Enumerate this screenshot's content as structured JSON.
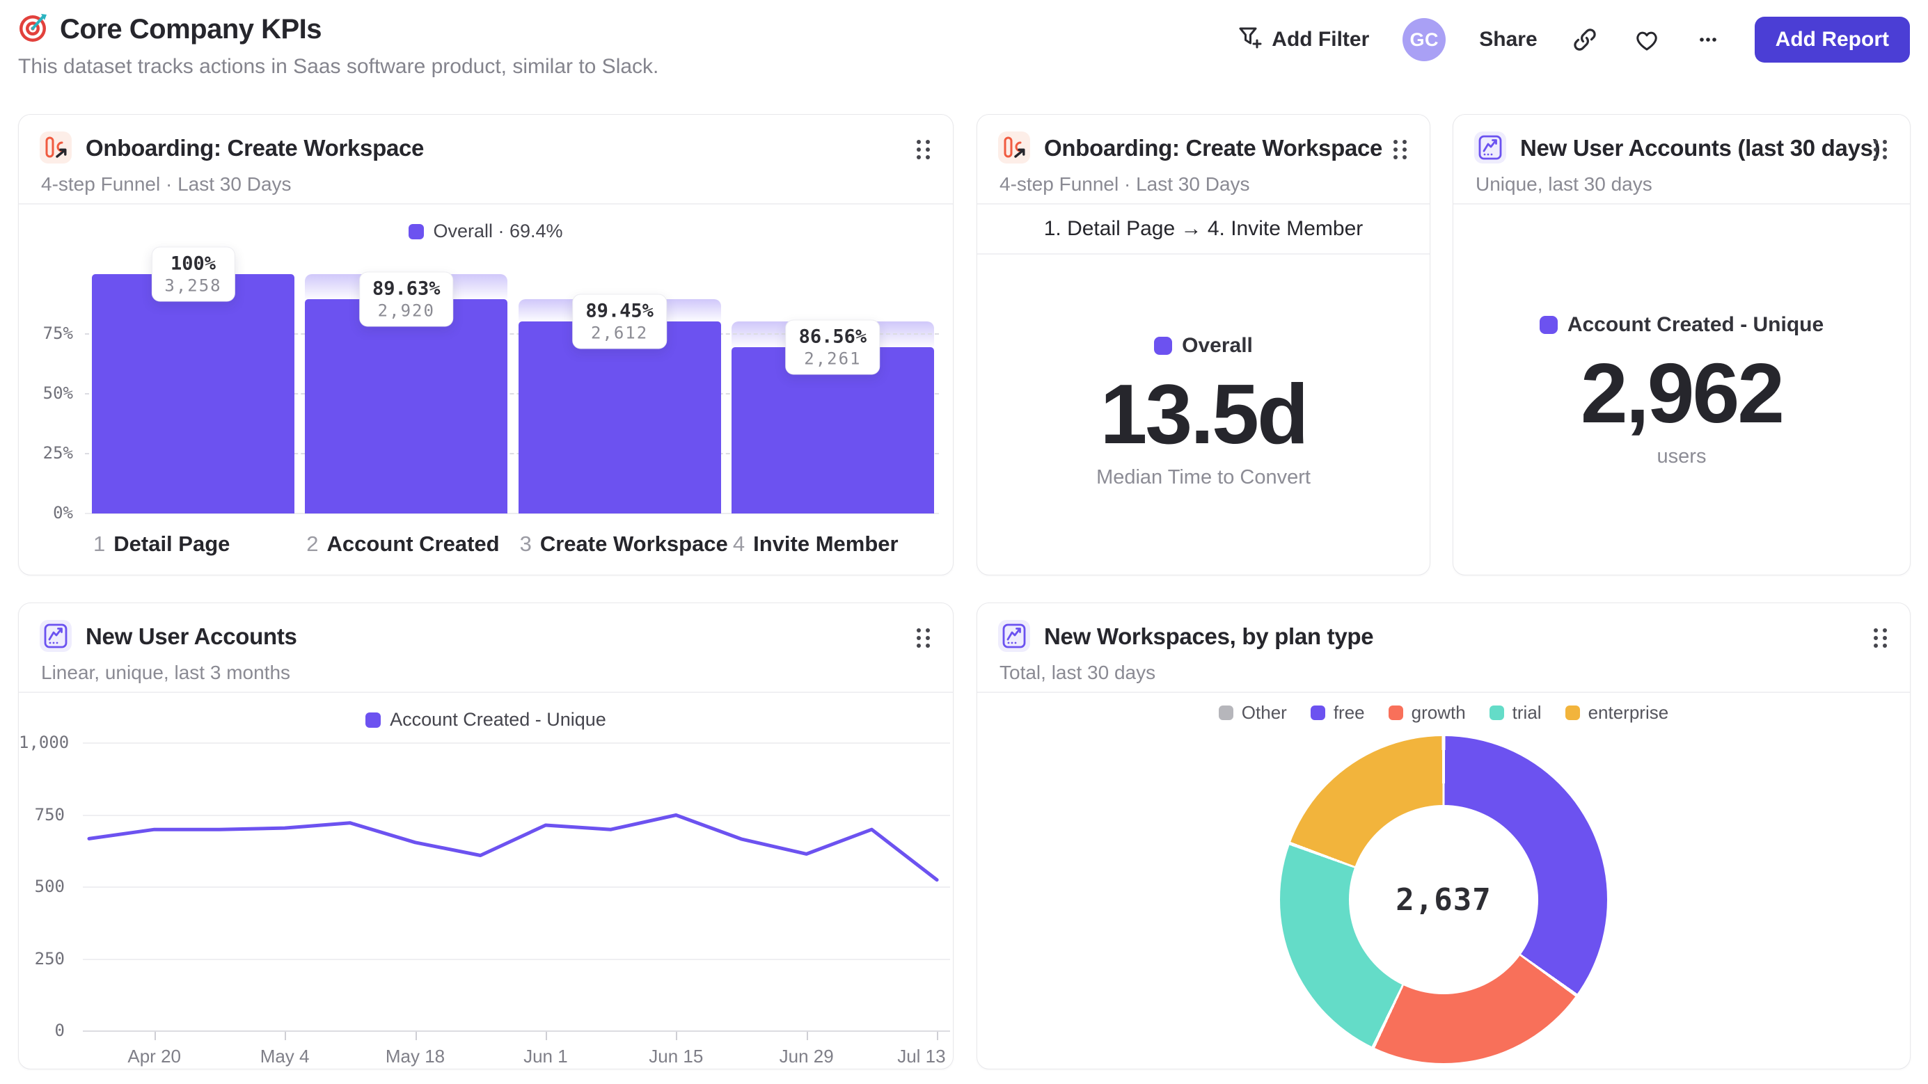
{
  "colors": {
    "purple": "#6c52f0",
    "button_indigo": "#4b3ed5",
    "coral": "#f8705a",
    "teal": "#64dcc8",
    "amber": "#f2b43c",
    "gray": "#b6b6bb",
    "funnel_icon_orange": "#f05b40"
  },
  "header": {
    "title": "Core Company KPIs",
    "subtitle": "This dataset tracks actions in Saas software product, similar to Slack.",
    "add_filter_label": "Add Filter",
    "avatar_initials": "GC",
    "share_label": "Share",
    "more_label": "•••",
    "add_report_label": "Add Report"
  },
  "cards": {
    "funnel": {
      "title": "Onboarding: Create Workspace",
      "subtitle": "4-step Funnel · Last 30 Days",
      "legend": "Overall · 69.4%"
    },
    "time_to_convert": {
      "title": "Onboarding: Create Workspace",
      "subtitle": "4-step Funnel · Last 30 Days",
      "range": "1. Detail Page → 4. Invite Member",
      "legend": "Overall",
      "value": "13.5d",
      "caption": "Median Time to Convert"
    },
    "new_accounts_30d": {
      "title": "New User Accounts (last 30 days)",
      "subtitle": "Unique, last 30 days",
      "legend": "Account Created - Unique",
      "value": "2,962",
      "caption": "users"
    },
    "accounts_trend": {
      "title": "New User Accounts",
      "subtitle": "Linear, unique, last 3 months",
      "legend": "Account Created - Unique"
    },
    "workspaces_by_plan": {
      "title": "New Workspaces, by plan type",
      "subtitle": "Total, last 30 days"
    }
  },
  "chart_data": [
    {
      "id": "funnel",
      "type": "bar",
      "title": "Onboarding: Create Workspace",
      "legend": "Overall · 69.4%",
      "overall_conversion_pct": 69.4,
      "categories": [
        "Detail Page",
        "Account Created",
        "Create Workspace",
        "Invite Member"
      ],
      "step_numbers": [
        "1",
        "2",
        "3",
        "4"
      ],
      "values": [
        3258,
        2920,
        2612,
        2261
      ],
      "value_labels": [
        "3,258",
        "2,920",
        "2,612",
        "2,261"
      ],
      "step_pct_labels": [
        "100%",
        "89.63%",
        "89.45%",
        "86.56%"
      ],
      "y_ticks": [
        "0%",
        "25%",
        "50%",
        "75%"
      ],
      "ylim": [
        0,
        100
      ],
      "color": "#6c52f0"
    },
    {
      "id": "accounts_trend",
      "type": "line",
      "title": "New User Accounts",
      "legend": "Account Created - Unique",
      "x": [
        "Apr 13",
        "Apr 20",
        "Apr 27",
        "May 4",
        "May 11",
        "May 18",
        "May 25",
        "Jun 1",
        "Jun 8",
        "Jun 15",
        "Jun 22",
        "Jun 29",
        "Jul 6",
        "Jul 13"
      ],
      "values": [
        668,
        700,
        700,
        705,
        723,
        655,
        610,
        715,
        700,
        750,
        667,
        615,
        700,
        525
      ],
      "x_tick_labels": [
        "Apr 20",
        "May 4",
        "May 18",
        "Jun 1",
        "Jun 15",
        "Jun 29",
        "Jul 13"
      ],
      "y_ticks": [
        "0",
        "250",
        "500",
        "750",
        "1,000"
      ],
      "ylim": [
        0,
        1000
      ],
      "grid": true,
      "color": "#6c52f0"
    },
    {
      "id": "workspaces_by_plan",
      "type": "pie",
      "title": "New Workspaces, by plan type",
      "total": 2637,
      "total_label": "2,637",
      "slices": [
        {
          "label": "Other",
          "value": 0,
          "color": "#b6b6bb"
        },
        {
          "label": "free",
          "value": 921,
          "color": "#6c52f0"
        },
        {
          "label": "growth",
          "value": 584,
          "color": "#f8705a"
        },
        {
          "label": "trial",
          "value": 620,
          "color": "#64dcc8"
        },
        {
          "label": "enterprise",
          "value": 512,
          "color": "#f2b43c"
        }
      ],
      "legend_position": "top"
    }
  ]
}
